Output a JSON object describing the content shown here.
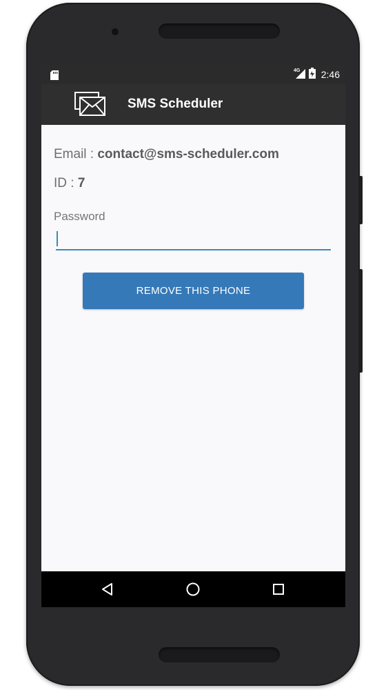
{
  "status_bar": {
    "time": "2:46",
    "network": "4G",
    "icons": [
      "sd-card-icon",
      "signal-icon",
      "battery-icon"
    ]
  },
  "toolbar": {
    "app_icon": "envelope-icon",
    "title": "SMS Scheduler"
  },
  "account": {
    "email_label": "Email : ",
    "email_value": "contact@sms-scheduler.com",
    "id_label": "ID : ",
    "id_value": "7"
  },
  "password": {
    "label": "Password",
    "value": ""
  },
  "actions": {
    "remove_label": "REMOVE THIS PHONE"
  },
  "nav": {
    "icons": [
      "back-icon",
      "home-icon",
      "recents-icon"
    ]
  },
  "colors": {
    "primary": "#3579b8",
    "toolbar": "#2f2f30",
    "accent": "#3a8bb5"
  }
}
